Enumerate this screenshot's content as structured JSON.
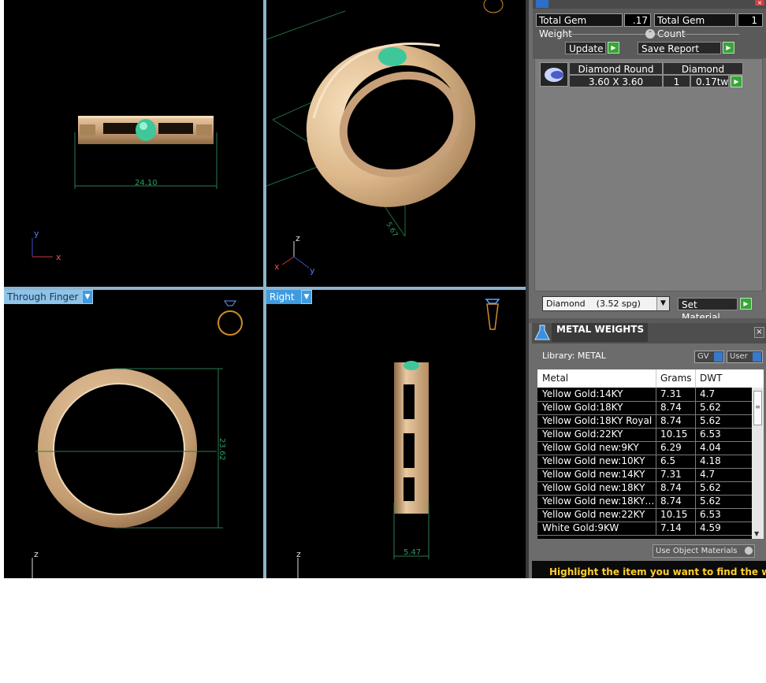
{
  "viewports": {
    "bottom_left_label": "Through Finger",
    "bottom_right_label": "Right",
    "dim_front_width": "24.10",
    "dim_persp_thickness": "5.67",
    "dim_through_height": "23.62",
    "dim_right_width": "5.47",
    "axis_x": "x",
    "axis_y": "y",
    "axis_z": "z"
  },
  "gem": {
    "total_weight_label": "Total Gem Weight",
    "total_weight_value": ".17",
    "total_count_label": "Total Gem Count",
    "total_count_value": "1",
    "update_label": "Update",
    "save_report_label": "Save Report",
    "table": {
      "col_shape": "Diamond Round",
      "col_type": "Diamond",
      "size": "3.60 X 3.60",
      "qty": "1",
      "weight": "0.17tw"
    },
    "material_select": "Diamond    (3.52 spg)",
    "set_material_label": "Set Material"
  },
  "metal": {
    "title": "METAL WEIGHTS",
    "library_label": "Library: METAL",
    "gv_label": "GV",
    "user_label": "User",
    "headers": [
      "Metal",
      "Grams",
      "DWT"
    ],
    "rows": [
      [
        "Yellow Gold:14KY",
        "7.31",
        "4.7"
      ],
      [
        "Yellow Gold:18KY",
        "8.74",
        "5.62"
      ],
      [
        "Yellow Gold:18KY Royal",
        "8.74",
        "5.62"
      ],
      [
        "Yellow Gold:22KY",
        "10.15",
        "6.53"
      ],
      [
        "Yellow Gold new:9KY",
        "6.29",
        "4.04"
      ],
      [
        "Yellow Gold new:10KY",
        "6.5",
        "4.18"
      ],
      [
        "Yellow Gold new:14KY",
        "7.31",
        "4.7"
      ],
      [
        "Yellow Gold new:18KY",
        "8.74",
        "5.62"
      ],
      [
        "Yellow Gold new:18KY…",
        "8.74",
        "5.62"
      ],
      [
        "Yellow Gold new:22KY",
        "10.15",
        "6.53"
      ],
      [
        "White Gold:9KW",
        "7.14",
        "4.59"
      ]
    ],
    "use_object_label": "Use Object Materials",
    "hint": "Highlight the item you want to find the weight"
  }
}
